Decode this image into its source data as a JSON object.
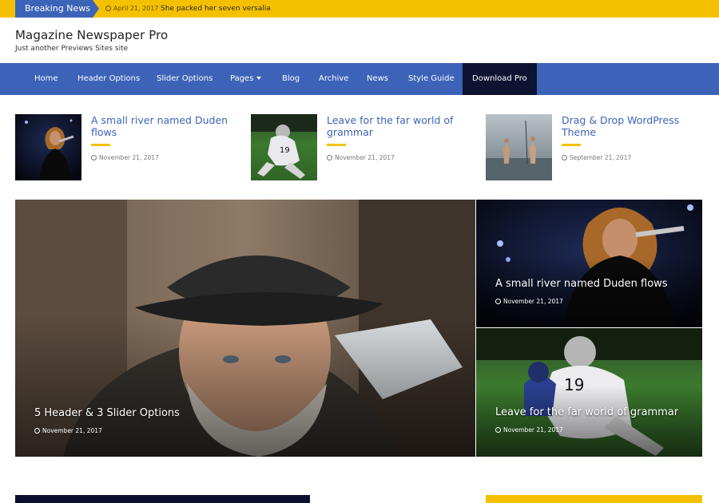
{
  "breaking": {
    "label": "Breaking News",
    "date": "April 21, 2017",
    "headline": "She packed her seven versalia"
  },
  "site": {
    "title": "Magazine Newspaper Pro",
    "description": "Just another Previews Sites site"
  },
  "nav": {
    "items": [
      {
        "label": "Home"
      },
      {
        "label": "Header Options"
      },
      {
        "label": "Slider Options"
      },
      {
        "label": "Pages"
      },
      {
        "label": "Blog"
      },
      {
        "label": "Archive"
      },
      {
        "label": "News"
      },
      {
        "label": "Style Guide"
      },
      {
        "label": "Download Pro"
      }
    ]
  },
  "mini_posts": [
    {
      "title": "A small river named Duden flows",
      "date": "November 21, 2017",
      "image": "singer-on-stage-photo"
    },
    {
      "title": "Leave for the far world of grammar",
      "date": "November 21, 2017",
      "image": "football-player-photo"
    },
    {
      "title": "Drag & Drop WordPress Theme",
      "date": "September 21, 2017",
      "image": "children-in-water-photo"
    }
  ],
  "featured": {
    "main": {
      "title": "5 Header & 3 Slider Options",
      "date": "November 21, 2017",
      "image": "old-man-portrait-photo"
    },
    "side": [
      {
        "title": "A small river named Duden flows",
        "date": "November 21, 2017",
        "image": "singer-on-stage-photo"
      },
      {
        "title": "Leave for the far world of grammar",
        "date": "November 21, 2017",
        "image": "football-player-photo"
      }
    ]
  },
  "colors": {
    "accent_blue": "#3c63b8",
    "accent_yellow": "#f5c000",
    "nav_dark": "#0d1330"
  },
  "icons": {
    "date": "clock-icon",
    "dropdown": "caret-down-icon"
  }
}
